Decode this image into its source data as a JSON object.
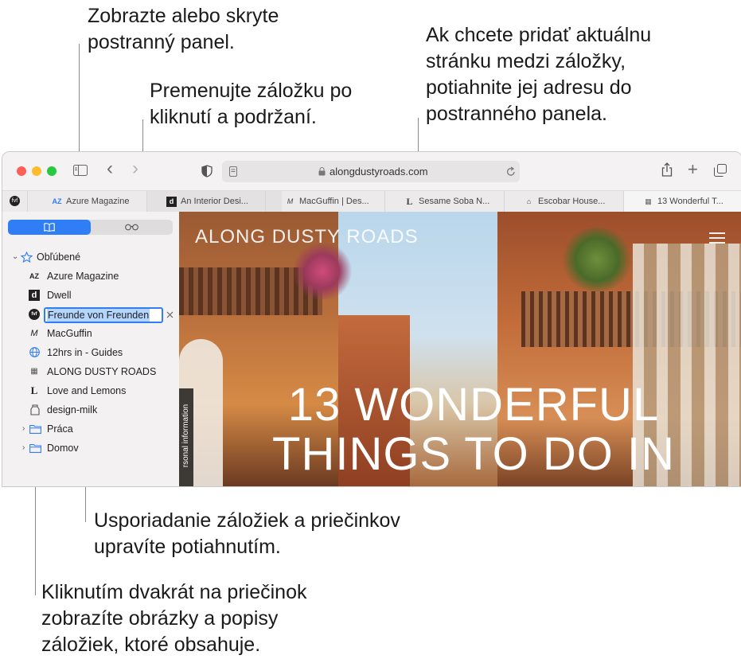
{
  "callouts": {
    "sidebar_toggle": "Zobrazte alebo skryte\npostranný panel.",
    "add_page": "Ak chcete pridať aktuálnu\nstránku medzi záložky,\npotiahnite jej adresu do\npostranného panela.",
    "rename": "Premenujte záložku po\nkliknutí a podržaní.",
    "reorder": "Usporiadanie záložiek a priečinkov\nupravíte potiahnutím.",
    "folder": "Kliknutím dvakrát na priečinok\nzobrazíte obrázky a popisy\nzáložiek, ktoré obsahuje."
  },
  "toolbar": {
    "url": "alongdustyroads.com",
    "colors": {
      "close": "#fe5f57",
      "minimize": "#febc2e",
      "zoom": "#28c840",
      "accent": "#2f7ef6"
    },
    "icons": {
      "sidebar": "sidebar-icon",
      "back": "‹",
      "forward": "›",
      "shield": "shield-icon",
      "reader": "reader-icon",
      "lock": "lock-icon",
      "reload": "reload-icon",
      "share": "share-icon",
      "new_tab": "+",
      "tabs_overview": "tabs-overview-icon"
    }
  },
  "tabs": [
    {
      "icon": "AZ",
      "label": "Azure Magazine"
    },
    {
      "icon": "d",
      "label": "An Interior Desi..."
    },
    {
      "icon": "M",
      "label": "MacGuffin | Des..."
    },
    {
      "icon": "L",
      "label": "Sesame Soba N..."
    },
    {
      "icon": "⌂",
      "label": "Escobar House..."
    },
    {
      "icon": "▦",
      "label": "13 Wonderful T..."
    }
  ],
  "sidebar": {
    "segments": {
      "bookmarks_icon": "book-icon",
      "reading_list_icon": "glasses-icon"
    },
    "favorites_label": "Obľúbené",
    "items": [
      {
        "icon": "AZ",
        "label": "Azure Magazine"
      },
      {
        "icon": "d",
        "label": "Dwell"
      },
      {
        "icon": "fvf",
        "label": "Freunde von Freunden",
        "editing": true
      },
      {
        "icon": "M",
        "label": "MacGuffin"
      },
      {
        "icon": "globe",
        "label": "12hrs in - Guides"
      },
      {
        "icon": "▦",
        "label": "ALONG DUSTY ROADS"
      },
      {
        "icon": "L",
        "label": "Love and Lemons"
      },
      {
        "icon": "dm",
        "label": "design-milk"
      }
    ],
    "folders": [
      {
        "label": "Práca"
      },
      {
        "label": "Domov"
      }
    ]
  },
  "hero": {
    "site_title": "ALONG DUSTY ROADS",
    "headline": "13 WONDERFUL\nTHINGS TO DO IN",
    "side_label": "rsonal information"
  }
}
